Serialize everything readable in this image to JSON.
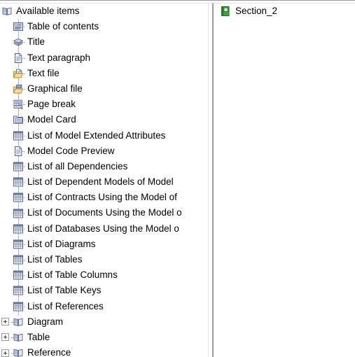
{
  "window": {
    "title": "Available items"
  },
  "left_panel": {
    "name": "available-items-tree",
    "root": {
      "label": "Available items",
      "icon": "book-icon",
      "expanded": true
    },
    "items": [
      {
        "label": "Table of contents",
        "icon": "table-of-contents-icon",
        "type": "leaf"
      },
      {
        "label": "Title",
        "icon": "title-icon",
        "type": "leaf"
      },
      {
        "label": "Text paragraph",
        "icon": "document-icon",
        "type": "leaf"
      },
      {
        "label": "Text file",
        "icon": "text-file-icon",
        "type": "leaf"
      },
      {
        "label": "Graphical file",
        "icon": "graphical-file-icon",
        "type": "leaf"
      },
      {
        "label": "Page break",
        "icon": "page-break-icon",
        "type": "leaf"
      },
      {
        "label": "Model Card",
        "icon": "model-card-icon",
        "type": "leaf"
      },
      {
        "label": "List of Model Extended Attributes",
        "icon": "grid-icon",
        "type": "leaf"
      },
      {
        "label": "Model Code Preview",
        "icon": "document-icon",
        "type": "leaf"
      },
      {
        "label": "List of all Dependencies",
        "icon": "grid-icon",
        "type": "leaf"
      },
      {
        "label": "List of Dependent Models of Model",
        "icon": "grid-icon",
        "type": "leaf"
      },
      {
        "label": "List of Contracts Using the Model of",
        "icon": "grid-icon",
        "type": "leaf"
      },
      {
        "label": "List of Documents Using the Model o",
        "icon": "grid-icon",
        "type": "leaf"
      },
      {
        "label": "List of Databases Using the Model o",
        "icon": "grid-icon",
        "type": "leaf"
      },
      {
        "label": "List of Diagrams",
        "icon": "grid-icon",
        "type": "leaf"
      },
      {
        "label": "List of Tables",
        "icon": "grid-icon",
        "type": "leaf"
      },
      {
        "label": "List of Table Columns",
        "icon": "grid-icon",
        "type": "leaf"
      },
      {
        "label": "List of Table Keys",
        "icon": "grid-icon",
        "type": "leaf"
      },
      {
        "label": "List of References",
        "icon": "grid-icon",
        "type": "leaf"
      },
      {
        "label": "Diagram",
        "icon": "book-icon",
        "type": "group",
        "expander": "+"
      },
      {
        "label": "Table",
        "icon": "book-icon",
        "type": "group",
        "expander": "+"
      },
      {
        "label": "Reference",
        "icon": "book-icon",
        "type": "group",
        "expander": "+"
      }
    ]
  },
  "right_panel": {
    "name": "selected-items-list",
    "items": [
      {
        "label": "Section_2",
        "icon": "section-book-icon"
      }
    ]
  },
  "colors": {
    "icon_blue": "#8a9ec8",
    "icon_blue_dark": "#55648c",
    "icon_green": "#3fa33f",
    "icon_green_dark": "#1d6b1d",
    "folder_yellow": "#f0c14b",
    "tree_line": "#808080",
    "text": "#000000",
    "background": "#ffffff",
    "scrollbar": "#9d9d9d"
  }
}
